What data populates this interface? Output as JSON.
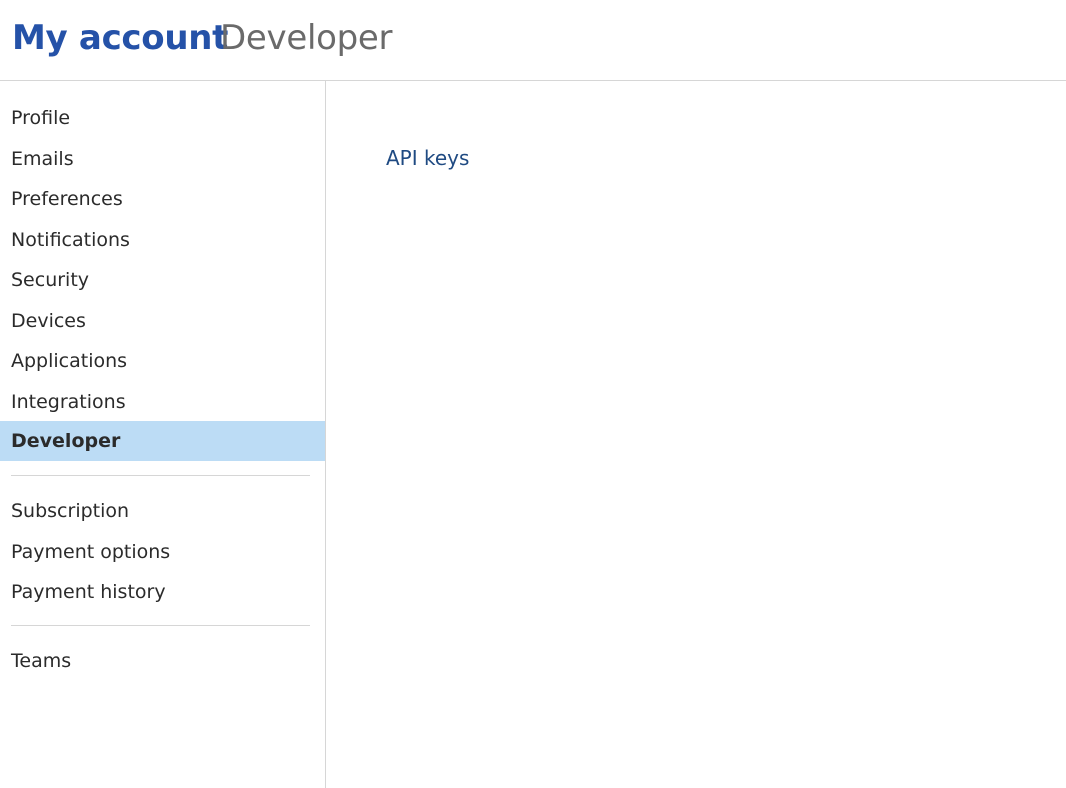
{
  "header": {
    "title": "My account",
    "subtitle": "Developer"
  },
  "sidebar": {
    "group1": [
      {
        "label": "Profile"
      },
      {
        "label": "Emails"
      },
      {
        "label": "Preferences"
      },
      {
        "label": "Notifications"
      },
      {
        "label": "Security"
      },
      {
        "label": "Devices"
      },
      {
        "label": "Applications"
      },
      {
        "label": "Integrations"
      },
      {
        "label": "Developer",
        "active": true
      }
    ],
    "group2": [
      {
        "label": "Subscription"
      },
      {
        "label": "Payment options"
      },
      {
        "label": "Payment history"
      }
    ],
    "group3": [
      {
        "label": "Teams"
      }
    ]
  },
  "main": {
    "links": [
      {
        "label": "API keys"
      }
    ]
  },
  "colors": {
    "title": "#2552a8",
    "active_bg": "#bcdcf5",
    "link": "#1f4a82"
  }
}
